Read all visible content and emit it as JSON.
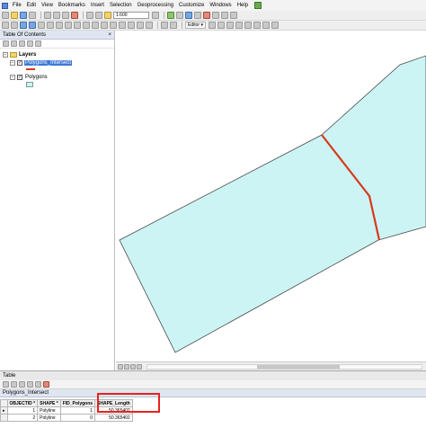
{
  "menu": {
    "items": [
      "File",
      "Edit",
      "View",
      "Bookmarks",
      "Insert",
      "Selection",
      "Geoprocessing",
      "Customize",
      "Windows",
      "Help"
    ]
  },
  "toolbar": {
    "scale_value": "1:600",
    "editor_label": "Editor ▾"
  },
  "toc": {
    "title": "Table Of Contents",
    "close_label": "×",
    "root_label": "Layers",
    "layers": [
      {
        "label": "Polygons_Intersect",
        "selected": true,
        "symbol": "line",
        "symbol_color": "#d63a1c"
      },
      {
        "label": "Polygons",
        "selected": false,
        "symbol": "polygon",
        "symbol_color": "#cdf4f4"
      }
    ]
  },
  "map": {
    "polygon_fill": "#cdf4f4",
    "polygon_stroke": "#4a4a4a",
    "line_color": "#d63a1c"
  },
  "table": {
    "window_title": "Table",
    "tab_label": "Polygons_Intersect",
    "columns": [
      "OBJECTID *",
      "SHAPE *",
      "FID_Polygons",
      "SHAPE_Length"
    ],
    "rows": [
      {
        "marker": "▸",
        "objectid": "1",
        "shape": "Polyline",
        "fid": "1",
        "length": "50.365402"
      },
      {
        "marker": "",
        "objectid": "2",
        "shape": "Polyline",
        "fid": "0",
        "length": "50.365402"
      }
    ]
  },
  "colors": {
    "selection_highlight": "#3c78d8",
    "annotation_box": "#e8221c"
  }
}
